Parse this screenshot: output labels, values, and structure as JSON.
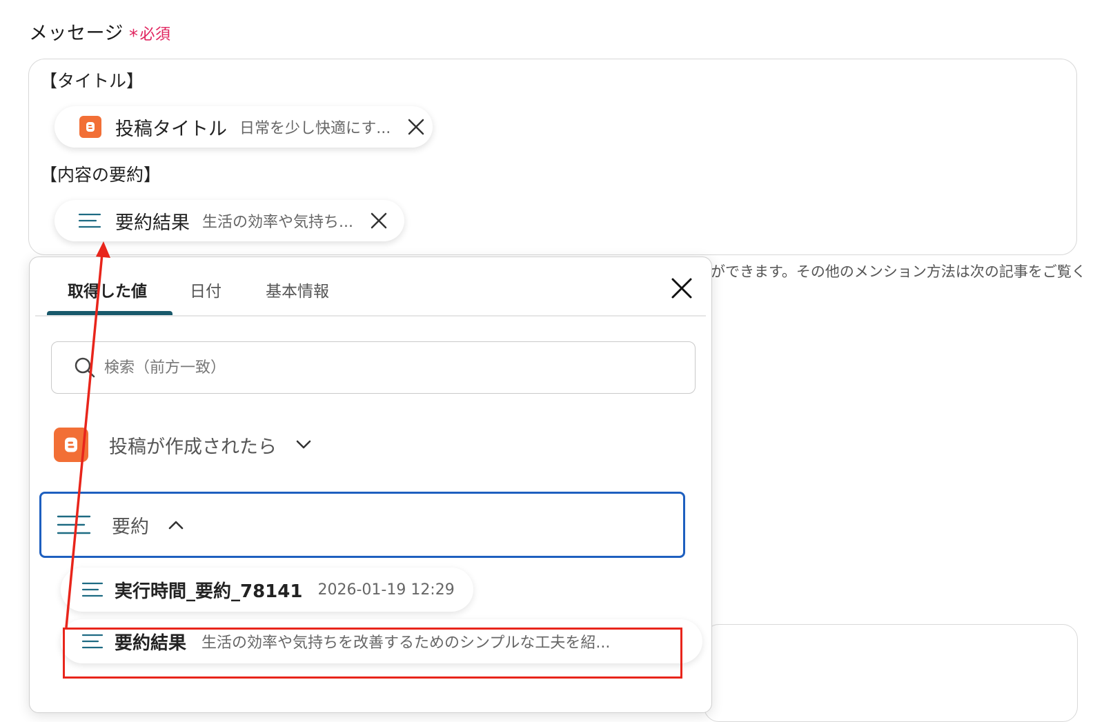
{
  "field": {
    "label": "メッセージ",
    "required_mark": "*",
    "required_text": "必須"
  },
  "message": {
    "line1": "【タイトル】",
    "line2": "【内容の要約】",
    "chips": [
      {
        "icon": "blogger-icon",
        "label": "投稿タイトル",
        "value": "日常を少し快適にす..."
      },
      {
        "icon": "lines-icon",
        "label": "要約結果",
        "value": "生活の効率や気持ち..."
      }
    ]
  },
  "helper_text": "ができます。その他のメンション方法は次の記事をご覧く",
  "popup": {
    "tabs": [
      "取得した値",
      "日付",
      "基本情報"
    ],
    "active_tab": 0,
    "search_placeholder": "検索（前方一致）",
    "groups": [
      {
        "icon": "blogger-icon",
        "label": "投稿が作成されたら",
        "expanded": false
      },
      {
        "icon": "lines-icon",
        "label": "要約",
        "expanded": true
      }
    ],
    "items": [
      {
        "label": "実行時間_要約_78141",
        "value": "2026-01-19 12:29"
      },
      {
        "label": "要約結果",
        "value": "生活の効率や気持ちを改善するためのシンプルな工夫を紹..."
      }
    ]
  },
  "colors": {
    "accent_tab": "#19596b",
    "selected_border": "#1e5fbf",
    "annotation_red": "#e8251b",
    "blogger_orange": "#f26f36",
    "required": "#e0245e"
  }
}
